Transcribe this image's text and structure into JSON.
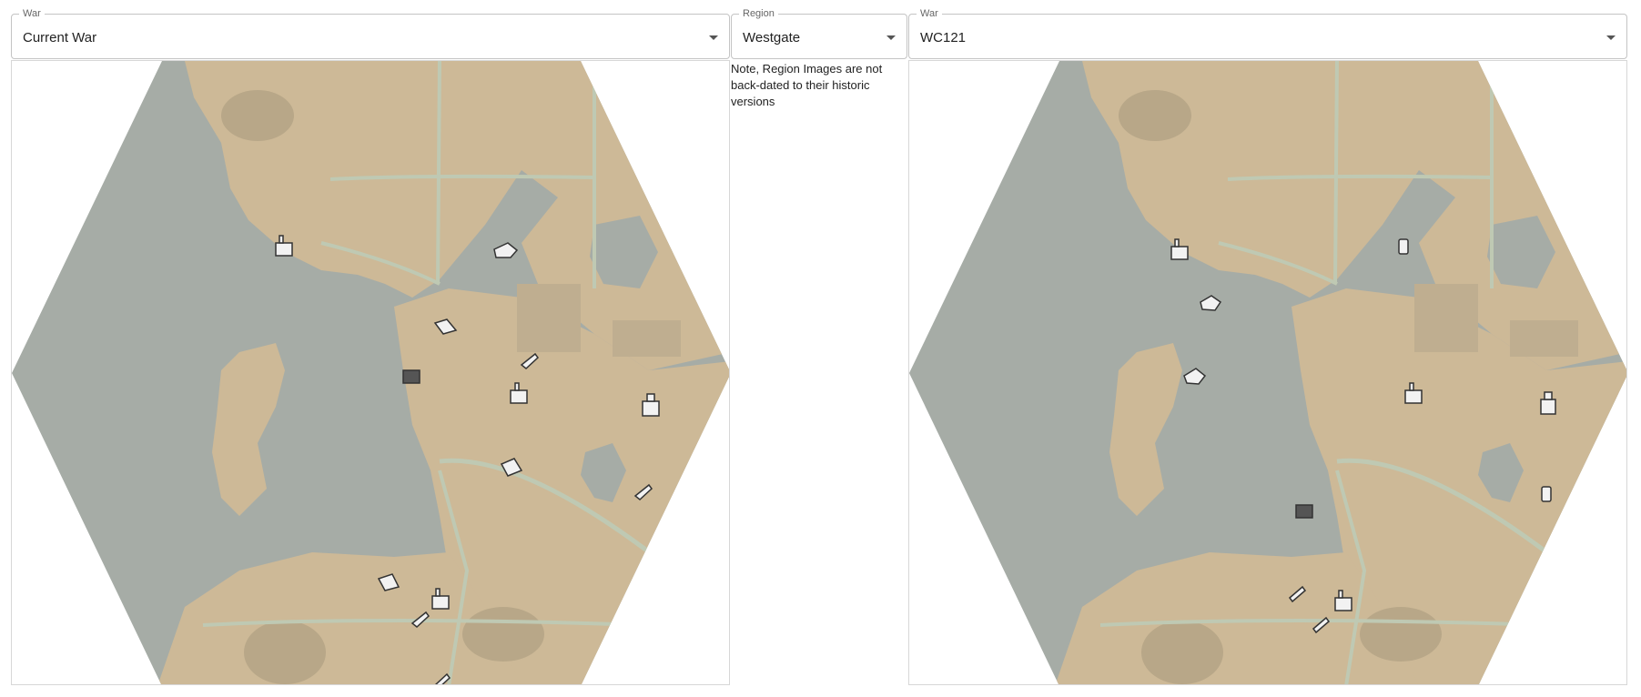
{
  "war_left": {
    "label": "War",
    "value": "Current War"
  },
  "region": {
    "label": "Region",
    "value": "Westgate"
  },
  "war_right": {
    "label": "War",
    "value": "WC121"
  },
  "note": "Note, Region Images are not back-dated to their historic versions",
  "icons": {
    "dropdown": "chevron-down-icon",
    "markers": [
      "factory-icon",
      "bunker-icon",
      "rocket-icon",
      "barrel-icon",
      "tank-icon",
      "base-icon"
    ]
  },
  "colors": {
    "land": "#cdb997",
    "water": "#a6aca6",
    "land_light": "#dccbab",
    "road": "#bfc9b3",
    "border": "#c4c4c4"
  }
}
